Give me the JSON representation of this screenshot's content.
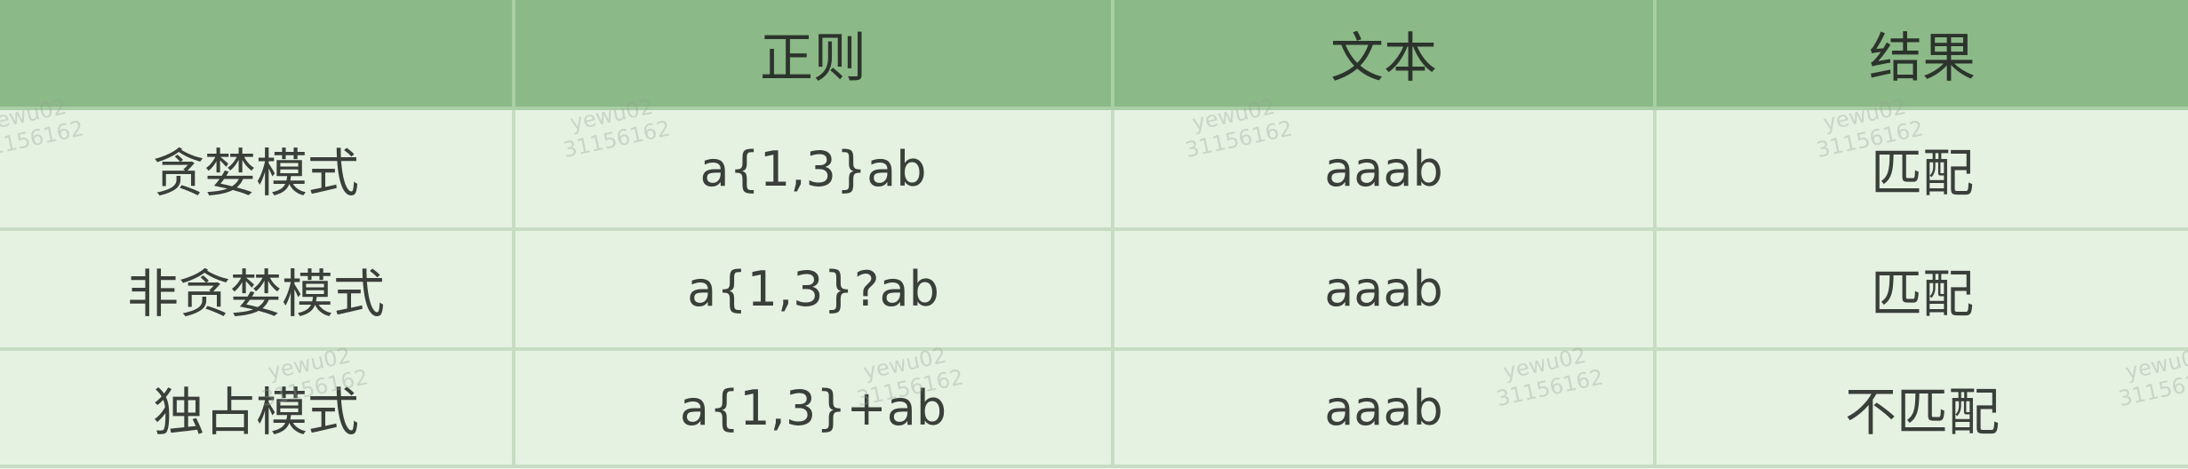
{
  "table": {
    "headers": [
      "",
      "正则",
      "文本",
      "结果"
    ],
    "rows": [
      {
        "mode": "贪婪模式",
        "regex": "a{1,3}ab",
        "text": "aaab",
        "result": "匹配"
      },
      {
        "mode": "非贪婪模式",
        "regex": "a{1,3}?ab",
        "text": "aaab",
        "result": "匹配"
      },
      {
        "mode": "独占模式",
        "regex": "a{1,3}+ab",
        "text": "aaab",
        "result": "不匹配"
      }
    ]
  },
  "watermark": {
    "line1": "yewu02",
    "line2": "31156162"
  },
  "colors": {
    "header_bg": "#8bb987",
    "row_bg": "#e5f2e2",
    "border": "#c7dcc3"
  }
}
